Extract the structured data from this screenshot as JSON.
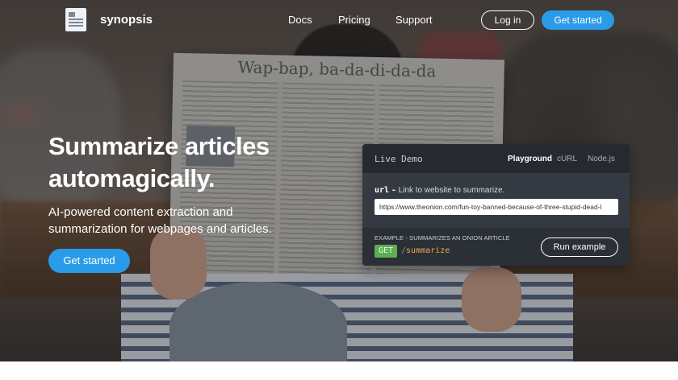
{
  "brand": {
    "name": "synopsis",
    "logo_icon": "newspaper-icon"
  },
  "nav": {
    "links": [
      "Docs",
      "Pricing",
      "Support"
    ],
    "login_label": "Log in",
    "cta_label": "Get started"
  },
  "hero": {
    "headline_line1": "Summarize articles",
    "headline_line2": "automagically.",
    "subtext_line1": "AI-powered content extraction and",
    "subtext_line2": "summarization for webpages and articles.",
    "cta_label": "Get started",
    "background_caption": "Wap-bap, ba-da-di-da-da"
  },
  "demo": {
    "title": "Live Demo",
    "tabs": [
      "Playground",
      "cURL",
      "Node.js"
    ],
    "active_tab": "Playground",
    "param_name": "url",
    "param_sep": "-",
    "param_desc": "Link to website to summarize.",
    "url_value": "https://www.theonion.com/fun-toy-banned-because-of-three-stupid-dead-l",
    "example_label": "EXAMPLE - SUMMARIZES AN ONION ARTICLE",
    "method": "GET",
    "endpoint_slash": "/",
    "endpoint_path": "summarize",
    "run_label": "Run example"
  },
  "colors": {
    "accent": "#2a9be8",
    "card_bg": "#2b2f36",
    "method_green": "#5fae53",
    "endpoint_orange": "#e8a64d"
  }
}
